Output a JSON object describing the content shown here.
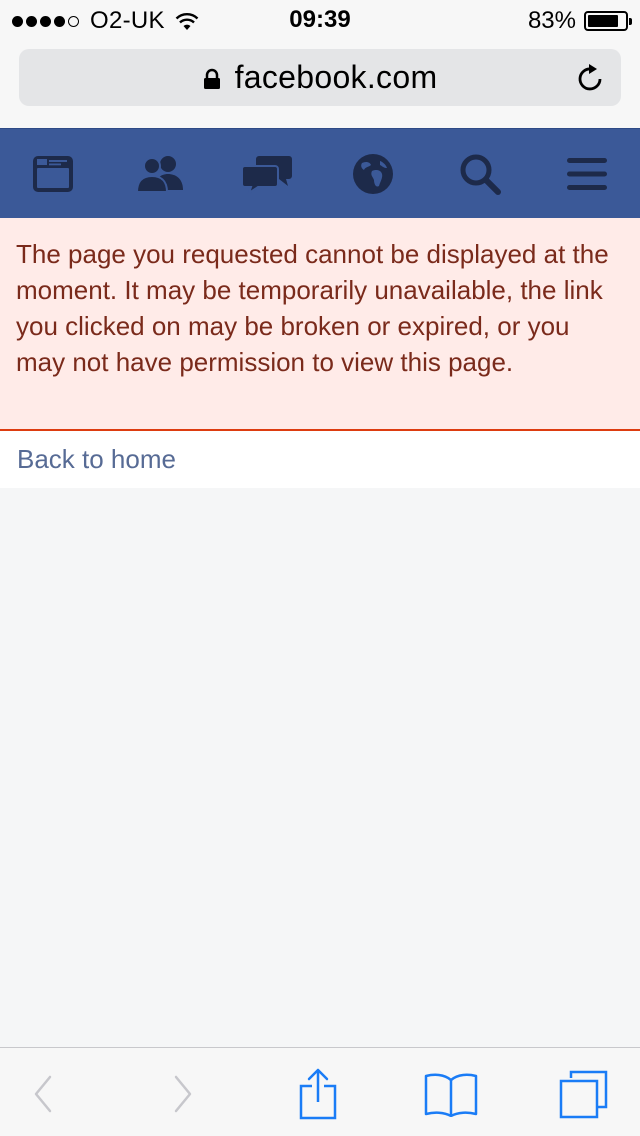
{
  "status_bar": {
    "signal_full_dots": 4,
    "signal_total_dots": 5,
    "carrier": "O2-UK",
    "time": "09:39",
    "battery_percent": "83%",
    "battery_level": 0.83
  },
  "browser": {
    "url": "facebook.com",
    "lock_icon": "lock-icon",
    "reload_icon": "reload-icon"
  },
  "fb_nav": {
    "background": "#3b5998",
    "icon_color": "#1d2a4a",
    "items": [
      {
        "icon": "news-feed-icon"
      },
      {
        "icon": "friend-requests-icon"
      },
      {
        "icon": "messages-icon"
      },
      {
        "icon": "notifications-globe-icon"
      },
      {
        "icon": "search-icon"
      },
      {
        "icon": "menu-icon"
      }
    ]
  },
  "error": {
    "message": "The page you requested cannot be displayed at the moment. It may be temporarily unavailable, the link you clicked on may be broken or expired, or you may not have permission to view this page.",
    "background": "#ffebe8",
    "text_color": "#7a2a1b",
    "border_color": "#dd3c10"
  },
  "links": {
    "back_home": "Back to home",
    "link_color": "#576b95"
  },
  "toolbar": {
    "accent": "#1a7cf6",
    "disabled": "#c7c7cc",
    "items": [
      {
        "icon": "back-arrow-icon",
        "enabled": false
      },
      {
        "icon": "forward-arrow-icon",
        "enabled": false
      },
      {
        "icon": "share-icon",
        "enabled": true
      },
      {
        "icon": "bookmarks-icon",
        "enabled": true
      },
      {
        "icon": "tabs-icon",
        "enabled": true
      }
    ]
  }
}
